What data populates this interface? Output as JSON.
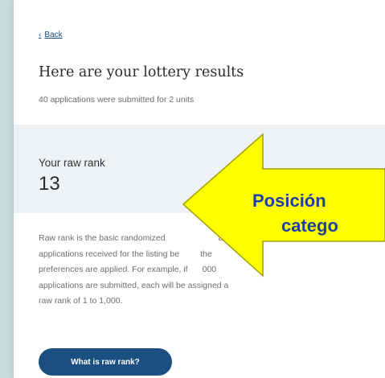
{
  "nav": {
    "back_label": "Back",
    "back_chevron": "‹"
  },
  "header": {
    "title": "Here are your lottery results",
    "subtitle": "40 applications were submitted for 2 units"
  },
  "rank": {
    "label": "Your raw rank",
    "value": "13"
  },
  "description": {
    "lines": [
      "Raw rank is the basic randomized",
      "all",
      "applications received for the listing be",
      "the",
      "preferences are applied. For example, if",
      "000",
      "applications are submitted, each will be assigned a",
      "raw rank of 1 to 1,000."
    ]
  },
  "help_button": {
    "label": "What is raw rank?"
  },
  "callout": {
    "line1": "Posición",
    "line2": "catego",
    "fill_color": "#ffff00",
    "stroke_color": "#a0a000",
    "text_color": "#1f3fa3"
  },
  "colors": {
    "accent": "#1b4f82",
    "panel": "#eef2f5",
    "frame": "#c9dcdd"
  }
}
